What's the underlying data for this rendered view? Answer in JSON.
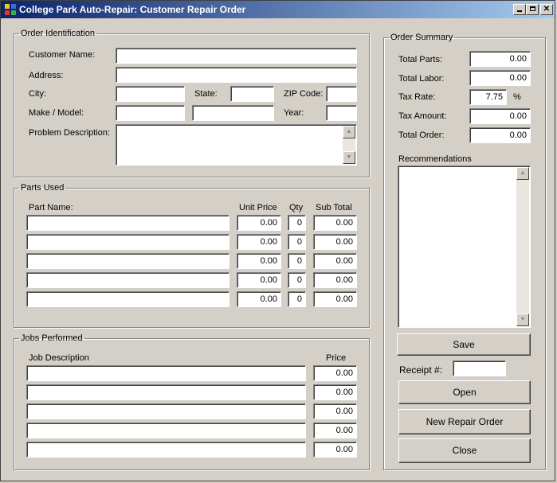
{
  "window": {
    "title": "College Park Auto-Repair: Customer Repair Order"
  },
  "order_identification": {
    "legend": "Order Identification",
    "customer_name_label": "Customer Name:",
    "address_label": "Address:",
    "city_label": "City:",
    "state_label": "State:",
    "zip_label": "ZIP Code:",
    "make_model_label": "Make / Model:",
    "year_label": "Year:",
    "problem_label": "Problem Description:",
    "customer_name": "",
    "address": "",
    "city": "",
    "state": "",
    "zip": "",
    "make": "",
    "model": "",
    "year": "",
    "problem": ""
  },
  "parts_used": {
    "legend": "Parts Used",
    "headers": {
      "part_name": "Part Name:",
      "unit_price": "Unit Price",
      "qty": "Qty",
      "sub_total": "Sub Total"
    },
    "rows": [
      {
        "name": "",
        "unit_price": "0.00",
        "qty": "0",
        "sub_total": "0.00"
      },
      {
        "name": "",
        "unit_price": "0.00",
        "qty": "0",
        "sub_total": "0.00"
      },
      {
        "name": "",
        "unit_price": "0.00",
        "qty": "0",
        "sub_total": "0.00"
      },
      {
        "name": "",
        "unit_price": "0.00",
        "qty": "0",
        "sub_total": "0.00"
      },
      {
        "name": "",
        "unit_price": "0.00",
        "qty": "0",
        "sub_total": "0.00"
      }
    ]
  },
  "jobs_performed": {
    "legend": "Jobs Performed",
    "headers": {
      "job_description": "Job Description",
      "price": "Price"
    },
    "rows": [
      {
        "description": "",
        "price": "0.00"
      },
      {
        "description": "",
        "price": "0.00"
      },
      {
        "description": "",
        "price": "0.00"
      },
      {
        "description": "",
        "price": "0.00"
      },
      {
        "description": "",
        "price": "0.00"
      }
    ]
  },
  "order_summary": {
    "legend": "Order Summary",
    "total_parts_label": "Total Parts:",
    "total_parts": "0.00",
    "total_labor_label": "Total Labor:",
    "total_labor": "0.00",
    "tax_rate_label": "Tax Rate:",
    "tax_rate": "7.75",
    "percent_sign": "%",
    "tax_amount_label": "Tax Amount:",
    "tax_amount": "0.00",
    "total_order_label": "Total Order:",
    "total_order": "0.00",
    "recommendations_label": "Recommendations",
    "recommendations": ""
  },
  "buttons": {
    "save": "Save",
    "receipt_label": "Receipt #:",
    "receipt_value": "",
    "open": "Open",
    "new_repair_order": "New Repair Order",
    "close": "Close"
  },
  "icons": {
    "minimize": "minimize-icon",
    "maximize": "maximize-icon",
    "close": "close-icon",
    "scroll_up": "scroll-up-arrow-icon",
    "scroll_down": "scroll-down-arrow-icon"
  },
  "colors": {
    "titlebar_start": "#0a246a",
    "titlebar_end": "#a6caf0",
    "face": "#d4d0c8"
  }
}
